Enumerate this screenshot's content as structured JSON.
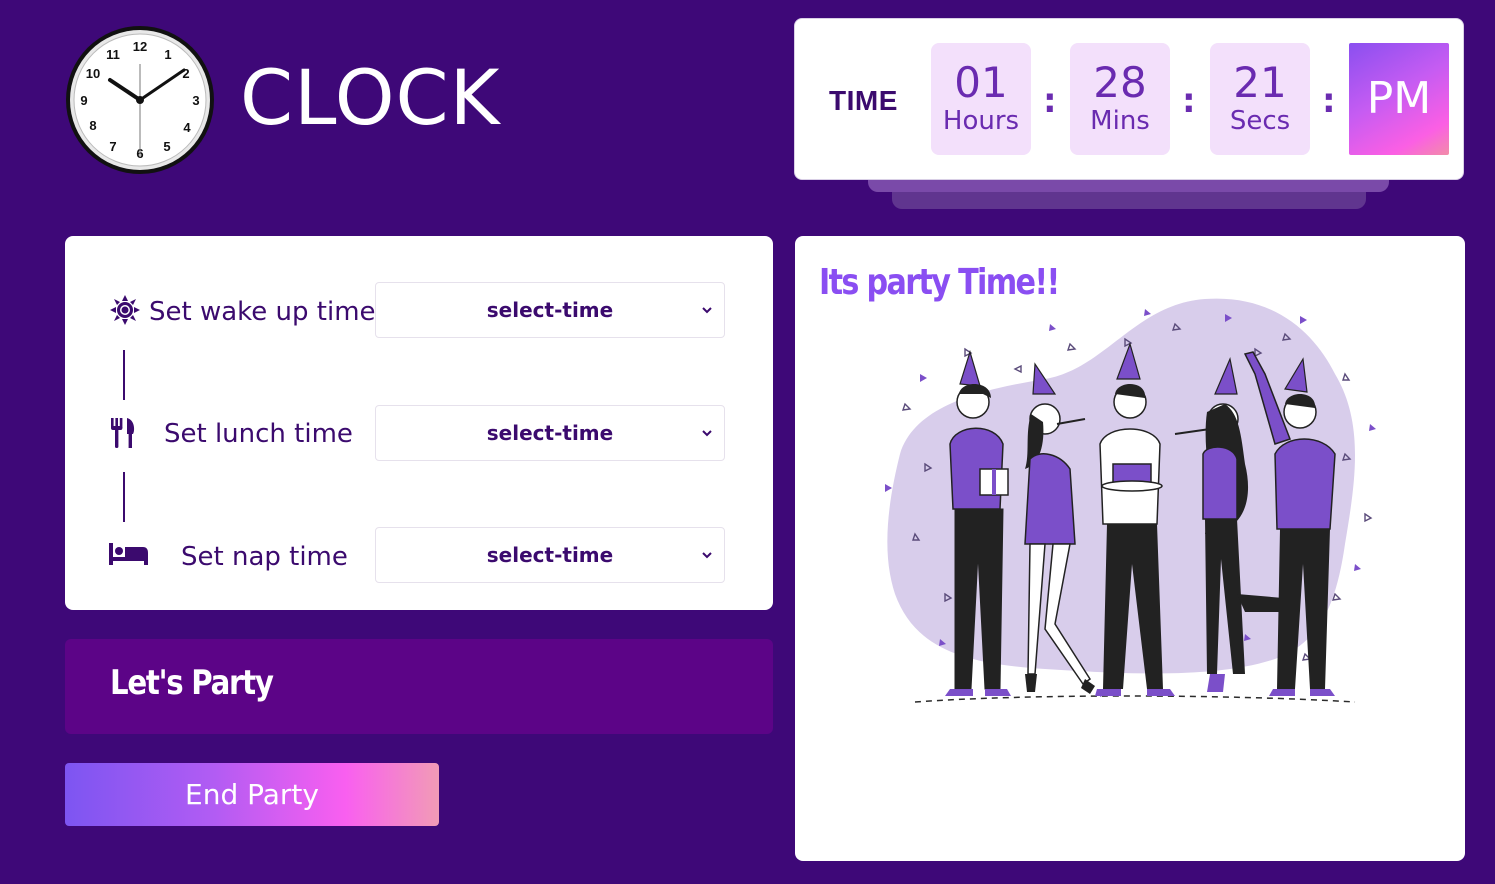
{
  "header": {
    "logo_icon": "analog-clock-icon",
    "title": "CLOCK",
    "clock_numbers": [
      "12",
      "1",
      "2",
      "3",
      "4",
      "5",
      "6",
      "7",
      "8",
      "9",
      "10",
      "11"
    ]
  },
  "time_card": {
    "label": "TIME",
    "hours": {
      "value": "01",
      "unit": "Hours"
    },
    "minutes": {
      "value": "28",
      "unit": "Mins"
    },
    "seconds": {
      "value": "21",
      "unit": "Secs"
    },
    "separator": ":",
    "ampm": "PM"
  },
  "settings": {
    "rows": [
      {
        "icon": "sun-icon",
        "label": "Set wake up time",
        "value": "select-time"
      },
      {
        "icon": "fork-knife-icon",
        "label": "Set lunch time",
        "value": "select-time"
      },
      {
        "icon": "bed-icon",
        "label": "Set nap time",
        "value": "select-time"
      }
    ]
  },
  "banner": {
    "text": "Let's Party"
  },
  "end_button": {
    "label": "End Party"
  },
  "party_panel": {
    "title": "Its party Time!!",
    "illustration_icon": "party-people-illustration"
  },
  "colors": {
    "background": "#3e0878",
    "accent_purple": "#8a4ef2",
    "dark_text": "#3b0a6e",
    "banner": "#5c0487",
    "time_box": "#f3e0fb",
    "gradient_start": "#7d55f2",
    "gradient_end": "#f95ff0"
  }
}
